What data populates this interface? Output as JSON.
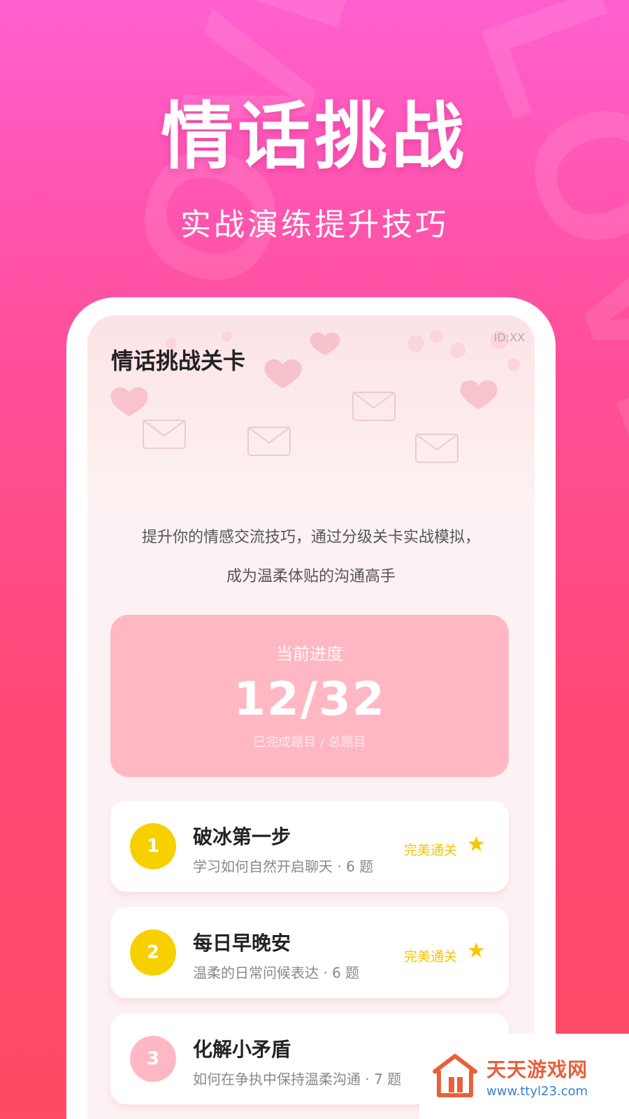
{
  "hero": {
    "title": "情话挑战",
    "subtitle": "实战演练提升技巧"
  },
  "screen": {
    "header_title": "情话挑战关卡",
    "id_label": "ID:XX",
    "description_line1": "提升你的情感交流技巧，通过分级关卡实战模拟，",
    "description_line2": "成为温柔体贴的沟通高手"
  },
  "progress": {
    "label": "当前进度",
    "value": "12/32",
    "completed": 12,
    "total": 32,
    "caption": "已完成题目 / 总题目"
  },
  "levels": [
    {
      "number": "1",
      "title": "破冰第一步",
      "subtitle": "学习如何自然开启聊天 · 6 题",
      "status": "完美通关",
      "color": "#f7d000"
    },
    {
      "number": "2",
      "title": "每日早晚安",
      "subtitle": "温柔的日常问候表达 · 6 题",
      "status": "完美通关",
      "color": "#f7d000"
    },
    {
      "number": "3",
      "title": "化解小矛盾",
      "subtitle": "如何在争执中保持温柔沟通 · 7 题",
      "status": "",
      "color": "#ffb8c3"
    }
  ],
  "watermark": {
    "name": "天天游戏网",
    "url": "www.ttyl23.com"
  },
  "colors": {
    "accent_pink": "#ff4f9c",
    "progress_card": "#ffb8c3",
    "gold": "#f7d000"
  }
}
